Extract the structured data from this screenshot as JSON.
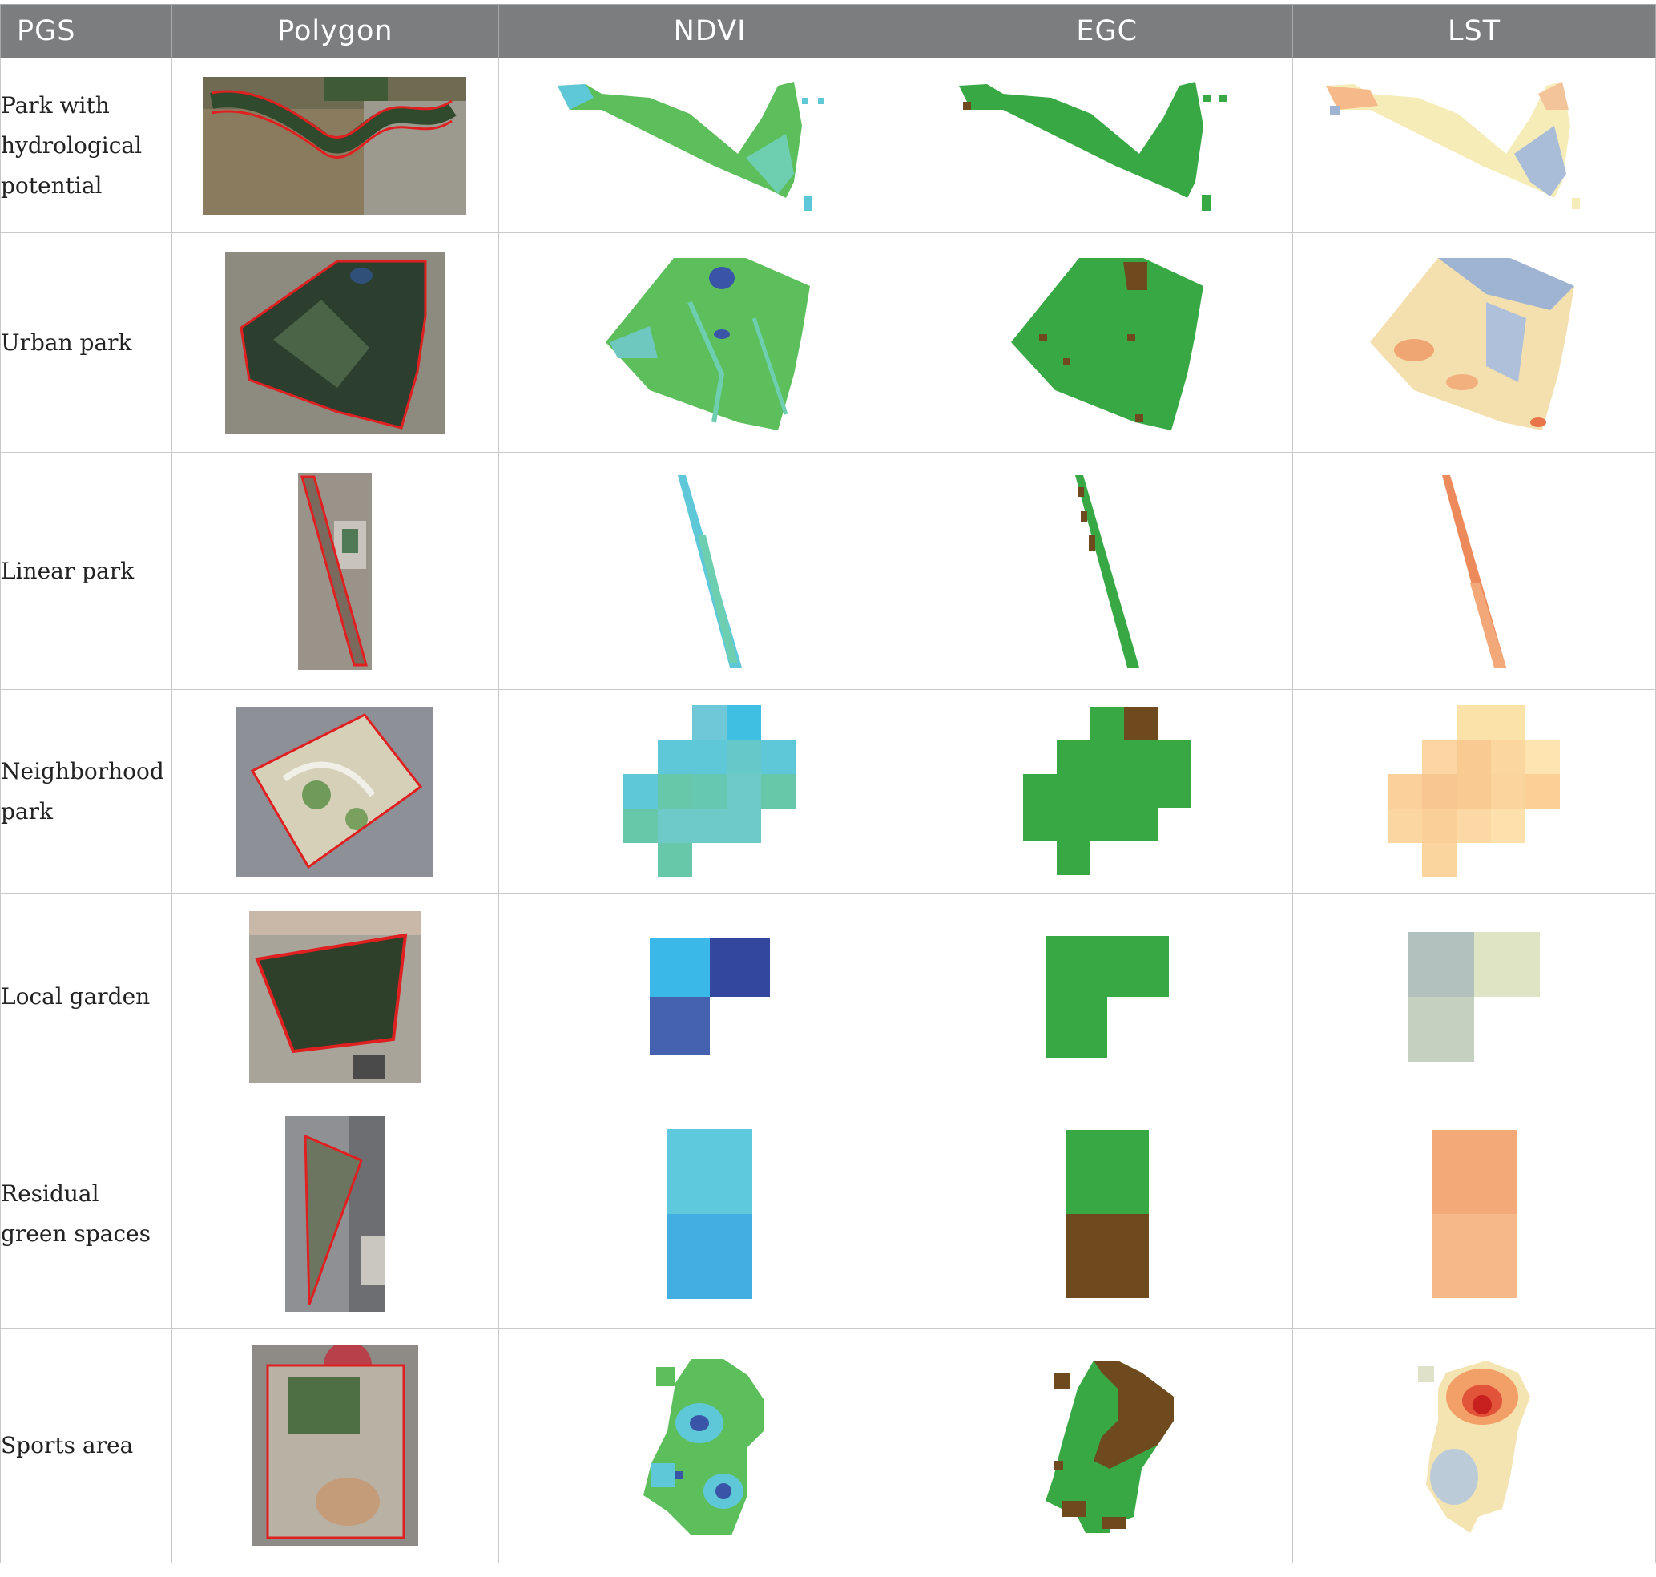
{
  "header": {
    "pgs": "PGS",
    "polygon": "Polygon",
    "ndvi": "NDVI",
    "egc": "EGC",
    "lst": "LST"
  },
  "rows": [
    {
      "label": "Park with hydrological potential"
    },
    {
      "label": "Urban park"
    },
    {
      "label": "Linear park"
    },
    {
      "label": "Neighborhood park"
    },
    {
      "label": "Local garden"
    },
    {
      "label": "Residual green spaces"
    },
    {
      "label": "Sports area"
    }
  ],
  "colors": {
    "header_bg": "#7c7d7f",
    "header_text": "#ffffff",
    "border": "#c9c9c9",
    "polygon_outline": "#e02020",
    "ndvi_green": "#5cbf5c",
    "ndvi_cyan": "#5ec8d8",
    "ndvi_blue": "#3a55a8",
    "egc_green": "#38a845",
    "egc_brown": "#6e4a1e",
    "lst_cool": "#9fb4d3",
    "lst_warm": "#f6c28e",
    "lst_hot": "#d83a24"
  }
}
